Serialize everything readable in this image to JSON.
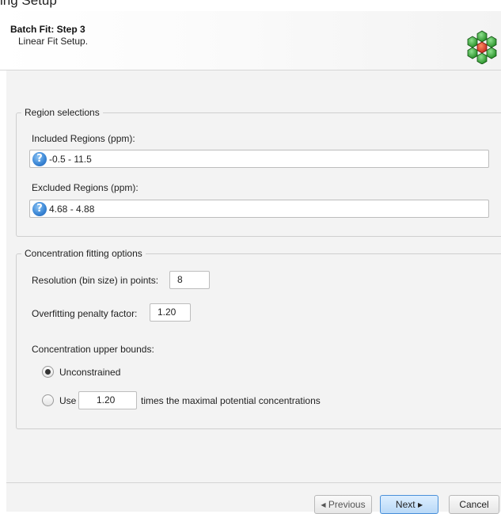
{
  "window": {
    "title": "ing Setup"
  },
  "header": {
    "step_title": "Batch Fit: Step 3",
    "step_subtitle": "Linear Fit Setup."
  },
  "region_selections": {
    "legend": "Region selections",
    "included_label": "Included Regions (ppm):",
    "included_value": "-0.5 - 11.5",
    "excluded_label": "Excluded Regions (ppm):",
    "excluded_value": "4.68 - 4.88",
    "help_glyph": "?"
  },
  "concentration": {
    "legend": "Concentration fitting options",
    "resolution_label": "Resolution (bin size) in points:",
    "resolution_value": "8",
    "overfitting_label": "Overfitting penalty factor:",
    "overfitting_value": "1.20",
    "bounds_label": "Concentration upper bounds:",
    "unconstrained_label": "Unconstrained",
    "unconstrained_selected": true,
    "use_label": "Use",
    "use_value": "1.20",
    "use_suffix": "times the maximal potential concentrations"
  },
  "footer": {
    "previous_label": "Previous",
    "next_label": "Next",
    "cancel_label": "Cancel"
  },
  "icons": {
    "logo": "hexagon-cluster-logo-icon",
    "help": "help-icon",
    "previous": "arrow-left-icon",
    "next": "arrow-right-icon"
  },
  "colors": {
    "logo_green": "#2e9e2e",
    "logo_red": "#d8322a",
    "primary_button": "#b9d9f7"
  }
}
